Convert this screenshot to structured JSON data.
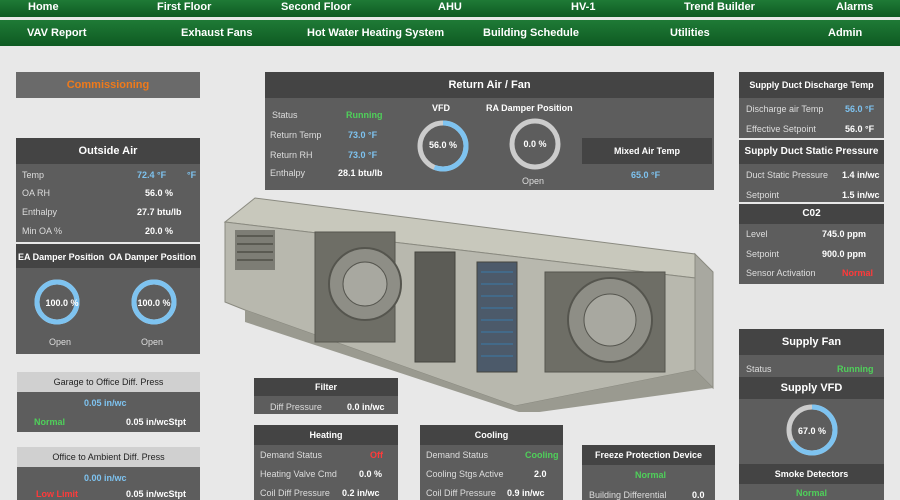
{
  "nav1": [
    "Home",
    "First Floor",
    "Second Floor",
    "AHU",
    "HV-1",
    "Trend Builder",
    "Alarms"
  ],
  "nav2": [
    "VAV Report",
    "Exhaust Fans",
    "Hot Water Heating System",
    "Building Schedule",
    "Utilities",
    "Admin"
  ],
  "commissioning": "Commissioning",
  "outside_air": {
    "title": "Outside Air",
    "rows": [
      {
        "label": "Temp",
        "value": "72.4 °F",
        "unit": "°F"
      },
      {
        "label": "OA RH",
        "value": "56.0  %"
      },
      {
        "label": "Enthalpy",
        "value": "27.7  btu/lb"
      },
      {
        "label": "Min OA %",
        "value": "20.0  %"
      }
    ]
  },
  "dampers": {
    "ea_title": "EA Damper Position",
    "oa_title": "OA Damper Position",
    "ea_value": "100.0  %",
    "oa_value": "100.0  %",
    "ea_state": "Open",
    "oa_state": "Open",
    "ea_pct": 100,
    "oa_pct": 100
  },
  "garage": {
    "title": "Garage to Office Diff. Press",
    "value": "0.05  in/wc",
    "status": "Normal",
    "stpt": "0.05  in/wcStpt"
  },
  "ambient": {
    "title": "Office to Ambient Diff. Press",
    "value": "0.00  in/wc",
    "status": "Low  Limit",
    "stpt": "0.05  in/wcStpt"
  },
  "return_air": {
    "title": "Return Air / Fan",
    "status_label": "Status",
    "status": "Running",
    "temp_label": "Return Temp",
    "temp": "73.0  °F",
    "rh_label": "Return RH",
    "rh": "73.0  °F",
    "enthalpy_label": "Enthalpy",
    "enthalpy": "28.1  btu/lb",
    "vfd_title": "VFD",
    "vfd_value": "56.0  %",
    "vfd_pct": 56,
    "ra_title": "RA  Damper Position",
    "ra_value": "0.0  %",
    "ra_pct": 0,
    "ra_state": "Open",
    "mixed_title": "Mixed Air Temp",
    "mixed_value": "65.0  °F"
  },
  "supply_discharge": {
    "title": "Supply Duct Discharge Temp",
    "rows": [
      {
        "label": "Discharge air Temp",
        "value": "56.0  °F"
      },
      {
        "label": "Effective Setpoint",
        "value": "56.0  °F"
      }
    ]
  },
  "static_pressure": {
    "title": "Supply Duct Static Pressure",
    "rows": [
      {
        "label": "Duct Static Pressure",
        "value": "1.4  in/wc"
      },
      {
        "label": "Setpoint",
        "value": "1.5  in/wc"
      }
    ]
  },
  "co2": {
    "title": "C02",
    "rows": [
      {
        "label": "Level",
        "value": "745.0  ppm"
      },
      {
        "label": "Setpoint",
        "value": "900.0  ppm"
      },
      {
        "label": "Sensor Activation",
        "value": "Normal"
      }
    ]
  },
  "supply_fan": {
    "title": "Supply Fan",
    "status_label": "Status",
    "status": "Running",
    "vfd_title": "Supply  VFD",
    "vfd_value": "67.0  %",
    "vfd_pct": 67,
    "smoke_title": "Smoke Detectors",
    "smoke_status": "Normal"
  },
  "filter": {
    "title": "Filter",
    "label": "Diff Pressure",
    "value": "0.0  in/wc"
  },
  "heating": {
    "title": "Heating",
    "rows": [
      {
        "label": "Demand Status",
        "value": "Off"
      },
      {
        "label": "Heating Valve Cmd",
        "value": "0.0  %"
      },
      {
        "label": "Coil Diff Pressure",
        "value": "0.2  in/wc"
      }
    ]
  },
  "cooling": {
    "title": "Cooling",
    "rows": [
      {
        "label": "Demand Status",
        "value": "Cooling"
      },
      {
        "label": "Cooling Stgs Active",
        "value": "2.0"
      },
      {
        "label": "Coil Diff Pressure",
        "value": "0.9  in/wc"
      }
    ]
  },
  "freeze": {
    "title": "Freeze Protection Device",
    "status": "Normal",
    "label": "Building Differential",
    "value": "0.0"
  },
  "colors": {
    "nav": "#1f7a36",
    "panel": "#5d5d5d",
    "header": "#444444",
    "blue": "#7ec3f0",
    "green": "#4fd05a",
    "red": "#ff3a3a",
    "orange": "#f07a1a"
  }
}
